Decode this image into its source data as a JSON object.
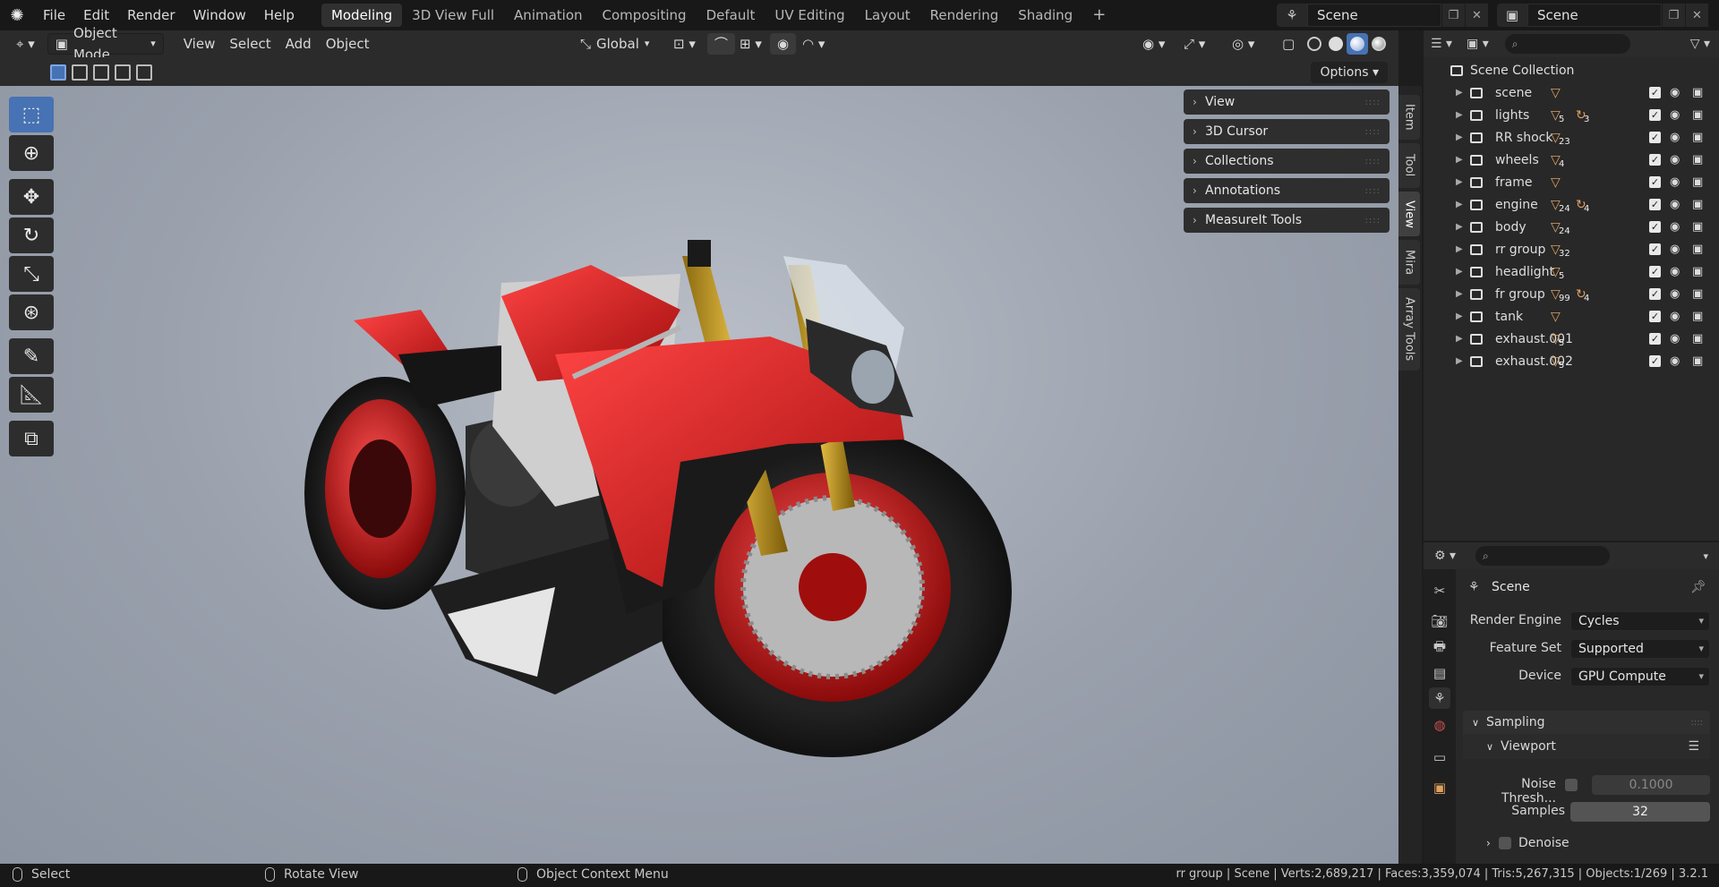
{
  "topbar": {
    "menus": [
      "File",
      "Edit",
      "Render",
      "Window",
      "Help"
    ],
    "workspaces": [
      "Modeling",
      "3D View Full",
      "Animation",
      "Compositing",
      "Default",
      "UV Editing",
      "Layout",
      "Rendering",
      "Shading"
    ],
    "active_workspace": "Modeling",
    "add_workspace": "+",
    "scene_name": "Scene",
    "view_layer_name": "Scene"
  },
  "viewport_header": {
    "mode": "Object Mode",
    "menus": [
      "View",
      "Select",
      "Add",
      "Object"
    ],
    "orientation": "Global"
  },
  "tool_settings": {
    "options_label": "Options"
  },
  "toolbar": {
    "tools": [
      "select-box",
      "cursor",
      "move",
      "rotate",
      "scale",
      "transform",
      "annotate",
      "measure",
      "add-cube"
    ],
    "active_tool": "select-box"
  },
  "n_panel": {
    "sections": [
      "View",
      "3D Cursor",
      "Collections",
      "Annotations",
      "MeasureIt Tools"
    ]
  },
  "side_tabs": [
    "Item",
    "Tool",
    "View",
    "Mira",
    "Array Tools"
  ],
  "active_side_tab": "View",
  "outliner": {
    "root": "Scene Collection",
    "rows": [
      {
        "name": "scene",
        "badges": [
          ""
        ]
      },
      {
        "name": "lights",
        "badges": [
          "5",
          "3"
        ]
      },
      {
        "name": "RR shock",
        "badges": [
          "23"
        ]
      },
      {
        "name": "wheels",
        "badges": [
          "4"
        ]
      },
      {
        "name": "frame",
        "badges": [
          ""
        ]
      },
      {
        "name": "engine",
        "badges": [
          "24",
          "4"
        ]
      },
      {
        "name": "body",
        "badges": [
          "24"
        ]
      },
      {
        "name": "rr group",
        "badges": [
          "32"
        ]
      },
      {
        "name": "headlight",
        "badges": [
          "5"
        ]
      },
      {
        "name": "fr group",
        "badges": [
          "99",
          "4"
        ]
      },
      {
        "name": "tank",
        "badges": [
          ""
        ]
      },
      {
        "name": "exhaust.001",
        "badges": [
          "5"
        ]
      },
      {
        "name": "exhaust.002",
        "badges": [
          "5"
        ]
      }
    ]
  },
  "properties": {
    "context": "Scene",
    "render_engine_label": "Render Engine",
    "render_engine": "Cycles",
    "feature_set_label": "Feature Set",
    "feature_set": "Supported",
    "device_label": "Device",
    "device": "GPU Compute",
    "sampling_label": "Sampling",
    "viewport_label": "Viewport",
    "noise_threshold_label": "Noise Thresh...",
    "noise_threshold": "0.1000",
    "samples_label": "Samples",
    "samples": "32",
    "denoise_label": "Denoise"
  },
  "statusbar": {
    "left_action": "Select",
    "middle_action": "Rotate View",
    "right_action": "Object Context Menu",
    "stats": "rr group | Scene | Verts:2,689,217 | Faces:3,359,074 | Tris:5,267,315 | Objects:1/269 | 3.2.1"
  },
  "colors": {
    "accent": "#4772b3",
    "bg": "#1d1d1d",
    "panel": "#282828",
    "mesh_icon": "#e0a060"
  }
}
